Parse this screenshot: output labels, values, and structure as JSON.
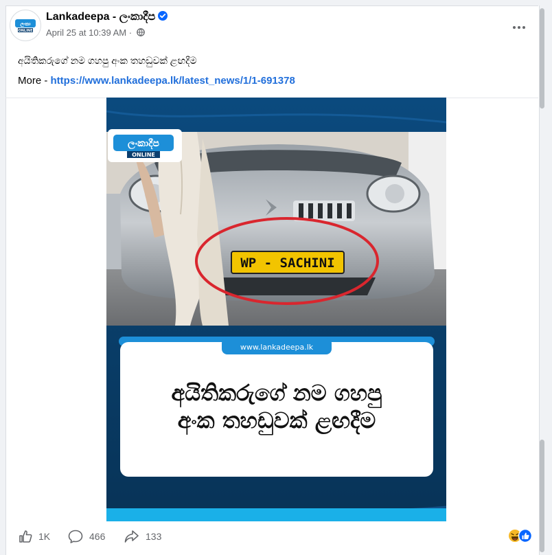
{
  "post": {
    "page_name": "Lankadeepa - ලංකාදීප",
    "timestamp": "April 25 at 10:39 AM",
    "meta_separator": "·",
    "caption": "අයිතිකරුගේ නම ගහපු අංක තහඩුවක් ළඟදීම",
    "more_label": "More - ",
    "link_text": "https://www.lankadeepa.lk/latest_news/1/1-691378"
  },
  "image": {
    "logo_text": "ලංකාදීප",
    "logo_subtext": "ONLINE",
    "plate_text": "WP - SACHINI",
    "site_label": "www.lankadeepa.lk",
    "headline_line1": "අයිතිකරුගේ නම ගහපු",
    "headline_line2": "අංක තහඩුවක් ළඟදීම"
  },
  "actions": {
    "likes": "1K",
    "comments": "466",
    "shares": "133"
  },
  "colors": {
    "link": "#216fdb",
    "brand_blue": "#0a3e6e",
    "plate_yellow": "#f2c400",
    "circle_red": "#d9262e"
  },
  "icons": [
    "verified-badge-icon",
    "globe-icon",
    "more-options-icon",
    "like-icon",
    "comment-icon",
    "share-icon",
    "haha-reaction-icon",
    "like-reaction-icon"
  ]
}
